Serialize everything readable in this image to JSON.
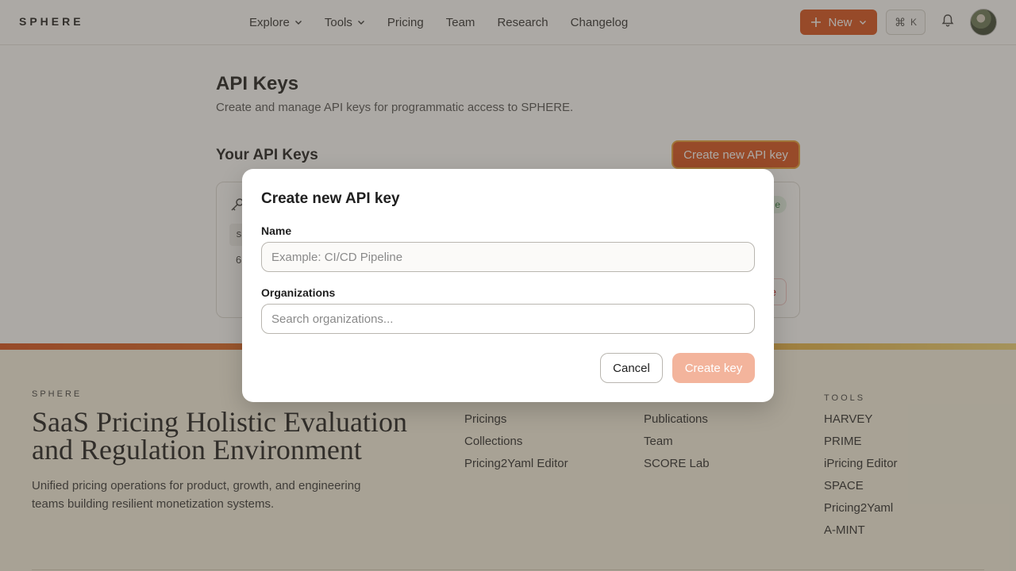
{
  "header": {
    "logo": "SPHERE",
    "nav": [
      {
        "label": "Explore",
        "dropdown": true
      },
      {
        "label": "Tools",
        "dropdown": true
      },
      {
        "label": "Pricing"
      },
      {
        "label": "Team"
      },
      {
        "label": "Research"
      },
      {
        "label": "Changelog"
      }
    ],
    "new_label": "New",
    "command_key": "⌘",
    "command_letter": "K",
    "accent_color": "#d9531e"
  },
  "main": {
    "title": "API Keys",
    "subtitle": "Create and manage API keys for programmatic access to SPHERE.",
    "section_title": "Your API Keys",
    "create_button": "Create new API key",
    "key_card": {
      "prefix_partial": "s",
      "count_partial": "6",
      "badge_partial": "e",
      "revoke_partial": "e"
    }
  },
  "footer": {
    "brand": "SPHERE",
    "title": "SaaS Pricing Holistic Evaluation and Regulation Environment",
    "description": "Unified pricing operations for product, growth, and engineering teams building resilient monetization systems.",
    "col_products": [
      "Pricings",
      "Collections",
      "Pricing2Yaml Editor"
    ],
    "col_research": [
      "Publications",
      "Team",
      "SCORE Lab"
    ],
    "col_tools_title": "TOOLS",
    "col_tools": [
      "HARVEY",
      "PRIME",
      "iPricing Editor",
      "SPACE",
      "Pricing2Yaml",
      "A-MINT"
    ]
  },
  "modal": {
    "title": "Create new API key",
    "name_label": "Name",
    "name_placeholder": "Example: CI/CD Pipeline",
    "name_value": "",
    "org_label": "Organizations",
    "org_placeholder": "Search organizations...",
    "org_value": "",
    "cancel_label": "Cancel",
    "create_label": "Create key"
  }
}
